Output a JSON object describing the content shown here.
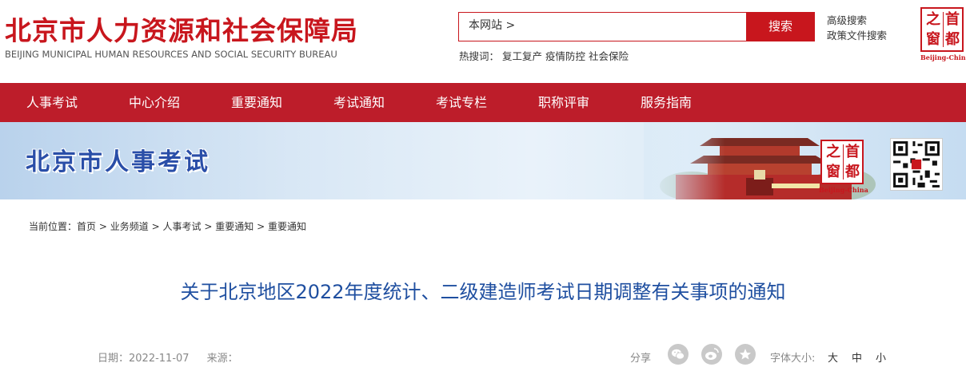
{
  "header": {
    "site_name_cn": "北京市人力资源和社会保障局",
    "site_name_en": "BEIJING MUNICIPAL HUMAN RESOURCES AND SOCIAL SECURITY BUREAU",
    "search": {
      "value": "本网站 >",
      "button_label": "搜索"
    },
    "advanced_search_label": "高级搜索",
    "policy_search_label": "政策文件搜索",
    "hot_search": {
      "label": "热搜词：",
      "items": [
        "复工复产",
        "疫情防控",
        "社会保险"
      ]
    },
    "capital_logo": {
      "chars": [
        "之",
        "首",
        "窗",
        "都"
      ],
      "caption": "Beijing-China"
    }
  },
  "nav": {
    "items": [
      {
        "label": "人事考试"
      },
      {
        "label": "中心介绍"
      },
      {
        "label": "重要通知"
      },
      {
        "label": "考试通知"
      },
      {
        "label": "考试专栏"
      },
      {
        "label": "职称评审"
      },
      {
        "label": "服务指南"
      }
    ]
  },
  "banner": {
    "title": "北京市人事考试",
    "capital_logo": {
      "chars": [
        "之",
        "首",
        "窗",
        "都"
      ],
      "caption": "Beijing-China"
    },
    "qr_icon": "qr-code"
  },
  "breadcrumb": {
    "label": "当前位置：",
    "items": [
      "首页",
      "业务频道",
      "人事考试",
      "重要通知",
      "重要通知"
    ],
    "separator": ">"
  },
  "article": {
    "title": "关于北京地区2022年度统计、二级建造师考试日期调整有关事项的通知",
    "date_label": "日期：",
    "date": "2022-11-07",
    "source_label": "来源：",
    "source": "",
    "share_label": "分享",
    "share_icons": [
      "wechat-icon",
      "weibo-icon",
      "favorite-icon"
    ],
    "font_size_label": "字体大小:",
    "font_sizes": [
      "大",
      "中",
      "小"
    ]
  },
  "colors": {
    "brand_red": "#c8161d",
    "nav_red": "#bd1d2a",
    "title_blue": "#1f4fa0",
    "banner_blue": "#2a4ea8"
  }
}
